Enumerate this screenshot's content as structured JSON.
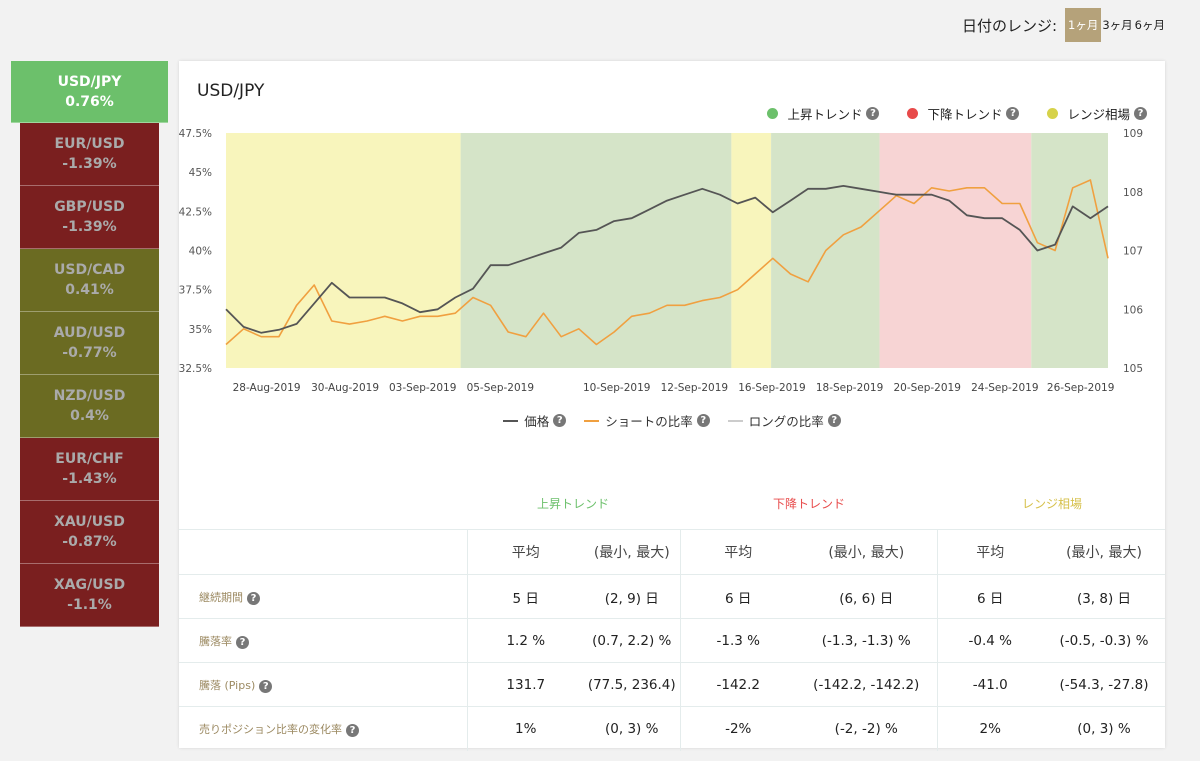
{
  "date_range": {
    "label": "日付のレンジ:",
    "options": [
      "1ヶ月",
      "3ヶ月",
      "6ヶ月"
    ],
    "selected": "1ヶ月"
  },
  "sidebar": {
    "items": [
      {
        "pair": "USD/JPY",
        "change": "0.76%",
        "trend": "up",
        "active": true
      },
      {
        "pair": "EUR/USD",
        "change": "-1.39%",
        "trend": "down"
      },
      {
        "pair": "GBP/USD",
        "change": "-1.39%",
        "trend": "down"
      },
      {
        "pair": "USD/CAD",
        "change": "0.41%",
        "trend": "range"
      },
      {
        "pair": "AUD/USD",
        "change": "-0.77%",
        "trend": "range"
      },
      {
        "pair": "NZD/USD",
        "change": "0.4%",
        "trend": "range"
      },
      {
        "pair": "EUR/CHF",
        "change": "-1.43%",
        "trend": "down"
      },
      {
        "pair": "XAU/USD",
        "change": "-0.87%",
        "trend": "down"
      },
      {
        "pair": "XAG/USD",
        "change": "-1.1%",
        "trend": "down"
      }
    ]
  },
  "card": {
    "title": "USD/JPY",
    "legend_top": [
      {
        "label": "上昇トレンド",
        "color": "#6cc06b"
      },
      {
        "label": "下降トレンド",
        "color": "#e84a4a"
      },
      {
        "label": "レンジ相場",
        "color": "#d6d24a"
      }
    ],
    "legend_bottom": [
      {
        "label": "価格",
        "color": "#555555"
      },
      {
        "label": "ショートの比率",
        "color": "#f0a040"
      },
      {
        "label": "ロングの比率",
        "color": "#cccccc"
      }
    ]
  },
  "colors": {
    "uptrend_band": "#d5e4c8",
    "downtrend_band": "#f7d4d4",
    "range_band": "#f8f5bc",
    "price_line": "#555555",
    "short_line": "#f0a040",
    "up_text": "#6cc06b",
    "down_text": "#e84a4a",
    "range_text": "#d6c04a"
  },
  "chart_data": {
    "type": "line",
    "x_tick_labels": [
      "28-Aug-2019",
      "30-Aug-2019",
      "03-Sep-2019",
      "05-Sep-2019",
      "10-Sep-2019",
      "12-Sep-2019",
      "16-Sep-2019",
      "18-Sep-2019",
      "20-Sep-2019",
      "24-Sep-2019",
      "26-Sep-2019"
    ],
    "x_tick_positions": [
      0.046,
      0.135,
      0.223,
      0.311,
      0.443,
      0.531,
      0.619,
      0.707,
      0.795,
      0.883,
      0.969
    ],
    "y_left_ticks": [
      "32.5%",
      "35%",
      "37.5%",
      "40%",
      "42.5%",
      "45%",
      "47.5%"
    ],
    "y_left_range": [
      32.5,
      47.5
    ],
    "y_right_ticks": [
      "105",
      "106",
      "107",
      "108",
      "109"
    ],
    "y_right_range": [
      105,
      109
    ],
    "bands": [
      {
        "trend": "range",
        "from": 0.0,
        "to": 0.266
      },
      {
        "trend": "up",
        "from": 0.266,
        "to": 0.573
      },
      {
        "trend": "range",
        "from": 0.573,
        "to": 0.618
      },
      {
        "trend": "up",
        "from": 0.618,
        "to": 0.741
      },
      {
        "trend": "down",
        "from": 0.741,
        "to": 0.913
      },
      {
        "trend": "up",
        "from": 0.913,
        "to": 1.0
      }
    ],
    "series": [
      {
        "name": "価格",
        "axis": "right",
        "x": [
          0.0,
          0.02,
          0.04,
          0.06,
          0.08,
          0.1,
          0.12,
          0.14,
          0.16,
          0.18,
          0.2,
          0.22,
          0.24,
          0.26,
          0.28,
          0.3,
          0.32,
          0.34,
          0.36,
          0.38,
          0.4,
          0.42,
          0.44,
          0.46,
          0.48,
          0.5,
          0.52,
          0.54,
          0.56,
          0.58,
          0.6,
          0.62,
          0.64,
          0.66,
          0.68,
          0.7,
          0.72,
          0.74,
          0.76,
          0.78,
          0.8,
          0.82,
          0.84,
          0.86,
          0.88,
          0.9,
          0.92,
          0.94,
          0.96,
          0.98,
          1.0
        ],
        "values": [
          106.0,
          105.7,
          105.6,
          105.65,
          105.75,
          106.1,
          106.45,
          106.2,
          106.2,
          106.2,
          106.1,
          105.95,
          106.0,
          106.2,
          106.35,
          106.75,
          106.75,
          106.85,
          106.95,
          107.05,
          107.3,
          107.35,
          107.5,
          107.55,
          107.7,
          107.85,
          107.95,
          108.05,
          107.95,
          107.8,
          107.9,
          107.65,
          107.85,
          108.05,
          108.05,
          108.1,
          108.05,
          108.0,
          107.95,
          107.95,
          107.95,
          107.85,
          107.6,
          107.55,
          107.55,
          107.35,
          107.0,
          107.1,
          107.75,
          107.55,
          107.75
        ]
      },
      {
        "name": "ショートの比率",
        "axis": "left",
        "x": [
          0.0,
          0.02,
          0.04,
          0.06,
          0.08,
          0.1,
          0.12,
          0.14,
          0.16,
          0.18,
          0.2,
          0.22,
          0.24,
          0.26,
          0.28,
          0.3,
          0.32,
          0.34,
          0.36,
          0.38,
          0.4,
          0.42,
          0.44,
          0.46,
          0.48,
          0.5,
          0.52,
          0.54,
          0.56,
          0.58,
          0.6,
          0.62,
          0.64,
          0.66,
          0.68,
          0.7,
          0.72,
          0.74,
          0.76,
          0.78,
          0.8,
          0.82,
          0.84,
          0.86,
          0.88,
          0.9,
          0.92,
          0.94,
          0.96,
          0.98,
          1.0
        ],
        "values": [
          34.0,
          35.0,
          34.5,
          34.5,
          36.5,
          37.8,
          35.5,
          35.3,
          35.5,
          35.8,
          35.5,
          35.8,
          35.8,
          36.0,
          37.0,
          36.5,
          34.8,
          34.5,
          36.0,
          34.5,
          35.0,
          34.0,
          34.8,
          35.8,
          36.0,
          36.5,
          36.5,
          36.8,
          37.0,
          37.5,
          38.5,
          39.5,
          38.5,
          38.0,
          40.0,
          41.0,
          41.5,
          42.5,
          43.5,
          43.0,
          44.0,
          43.8,
          44.0,
          44.0,
          43.0,
          43.0,
          40.5,
          40.0,
          44.0,
          44.5,
          39.5
        ]
      }
    ]
  },
  "stats": {
    "trend_heads": [
      "上昇トレンド",
      "下降トレンド",
      "レンジ相場"
    ],
    "col_avg": "平均",
    "col_minmax": "(最小, 最大)",
    "rows": [
      {
        "label": "継続期間",
        "up_avg": "5 日",
        "up_mm": "(2, 9) 日",
        "down_avg": "6 日",
        "down_mm": "(6, 6) 日",
        "range_avg": "6 日",
        "range_mm": "(3, 8) 日"
      },
      {
        "label": "騰落率",
        "up_avg": "1.2 %",
        "up_mm": "(0.7, 2.2) %",
        "down_avg": "-1.3 %",
        "down_mm": "(-1.3, -1.3) %",
        "range_avg": "-0.4 %",
        "range_mm": "(-0.5, -0.3) %"
      },
      {
        "label": "騰落 (Pips)",
        "up_avg": "131.7",
        "up_mm": "(77.5, 236.4)",
        "down_avg": "-142.2",
        "down_mm": "(-142.2, -142.2)",
        "range_avg": "-41.0",
        "range_mm": "(-54.3, -27.8)"
      },
      {
        "label": "売りポジション比率の変化率",
        "up_avg": "1%",
        "up_mm": "(0, 3) %",
        "down_avg": "-2%",
        "down_mm": "(-2, -2) %",
        "range_avg": "2%",
        "range_mm": "(0, 3) %"
      }
    ]
  }
}
